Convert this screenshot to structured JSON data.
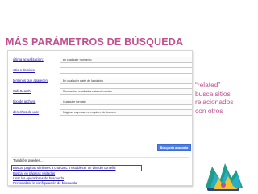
{
  "slide": {
    "title": "MÁS PARÁMETROS DE BÚSQUEDA"
  },
  "form": {
    "rows": [
      {
        "label": "última actualización:",
        "value": "en cualquier momento"
      },
      {
        "label": "sitio o dominio:",
        "value": ""
      },
      {
        "label": "términos que aparecen:",
        "value": "En cualquier parte de la página"
      },
      {
        "label": "SafeSearch:",
        "value": "Mostrar los resultados más relevantes"
      },
      {
        "label": "tipo de archivo:",
        "value": "Cualquier formato"
      },
      {
        "label": "derechos de uso:",
        "value": "Páginas cuyo uso no requiere de licencia"
      }
    ],
    "search_button": "Búsqueda avanzada"
  },
  "also": {
    "heading": "También puedes...",
    "links": [
      "Buscar páginas similares a una URL o establecer un vínculo con ella",
      "Buscar en páginas visitadas",
      "Usar los operadores de búsqueda",
      "Personalizar la configuración de búsqueda"
    ]
  },
  "callout": {
    "lines": [
      "“related”",
      "busca sitios",
      "relacionados",
      "con otros"
    ]
  },
  "colors": {
    "accent": "#c0508e",
    "link": "#1a0dab",
    "highlight": "#d01919",
    "button": "#4d7ee8"
  },
  "icons": {
    "logo": "flame-logo-icon"
  }
}
